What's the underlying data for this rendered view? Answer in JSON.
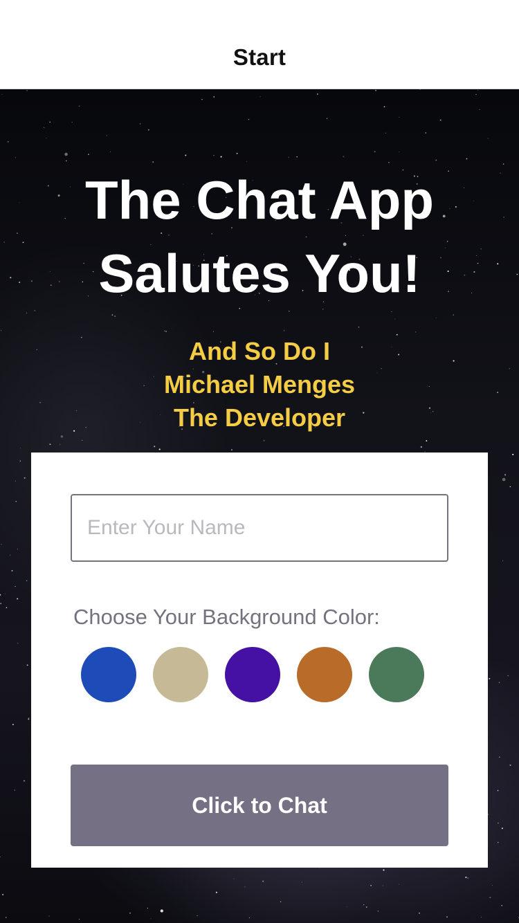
{
  "nav": {
    "title": "Start"
  },
  "hero": {
    "title_line1": "The Chat App",
    "title_line2": "Salutes You!",
    "sub_line1": "And So Do I",
    "sub_line2": "Michael Menges",
    "sub_line3": "The Developer"
  },
  "form": {
    "name_placeholder": "Enter Your Name",
    "name_value": "",
    "color_label": "Choose Your Background Color:",
    "colors": [
      {
        "name": "blue",
        "hex": "#1d4cb8"
      },
      {
        "name": "beige",
        "hex": "#c6b995"
      },
      {
        "name": "purple",
        "hex": "#4510a4"
      },
      {
        "name": "orange",
        "hex": "#b96b2a"
      },
      {
        "name": "green",
        "hex": "#4a7a5a"
      }
    ],
    "button_label": "Click to Chat"
  },
  "theme": {
    "accent_yellow": "#f4cd45",
    "button_gray": "#757083"
  }
}
